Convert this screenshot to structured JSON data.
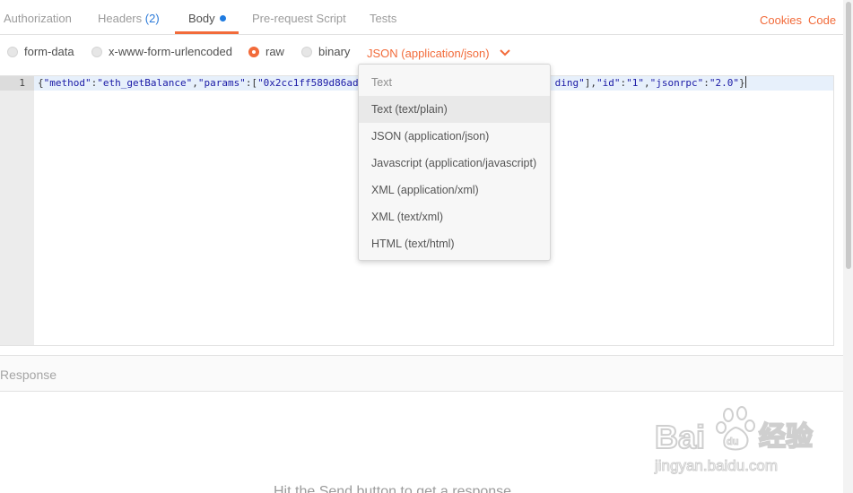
{
  "tabs": {
    "authorization": "Authorization",
    "headers": "Headers",
    "headers_count": "(2)",
    "body": "Body",
    "prerequest": "Pre-request Script",
    "tests": "Tests"
  },
  "links": {
    "cookies": "Cookies",
    "code": "Code"
  },
  "body_types": {
    "form_data": "form-data",
    "urlencoded": "x-www-form-urlencoded",
    "raw": "raw",
    "binary": "binary",
    "selected": "raw"
  },
  "content_type": {
    "label": "JSON (application/json)"
  },
  "editor": {
    "line_number": "1",
    "p1": "{",
    "s1": "\"method\"",
    "p2": ":",
    "s2": "\"eth_getBalance\"",
    "p3": ",",
    "s3": "\"params\"",
    "p4": ":[",
    "s4": "\"0x2cc1ff589d86ad",
    "s5": "ding\"",
    "p5": "],",
    "s6": "\"id\"",
    "p6": ":",
    "s7": "\"1\"",
    "p7": ",",
    "s8": "\"jsonrpc\"",
    "p8": ":",
    "s9": "\"2.0\"",
    "p9": "}"
  },
  "dropdown": {
    "header": "Text",
    "hovered_index": 0,
    "items": [
      "Text (text/plain)",
      "JSON (application/json)",
      "Javascript (application/javascript)",
      "XML (application/xml)",
      "XML (text/xml)",
      "HTML (text/html)"
    ]
  },
  "response": {
    "title": "Response",
    "hint": "Hit the Send button to get a response."
  },
  "watermark": {
    "brand": "Baidu 经验",
    "url": "jingyan.baidu.com"
  },
  "colors": {
    "accent": "#f26b3a",
    "link_blue": "#2b7ad9",
    "string": "#1a1aa6"
  }
}
